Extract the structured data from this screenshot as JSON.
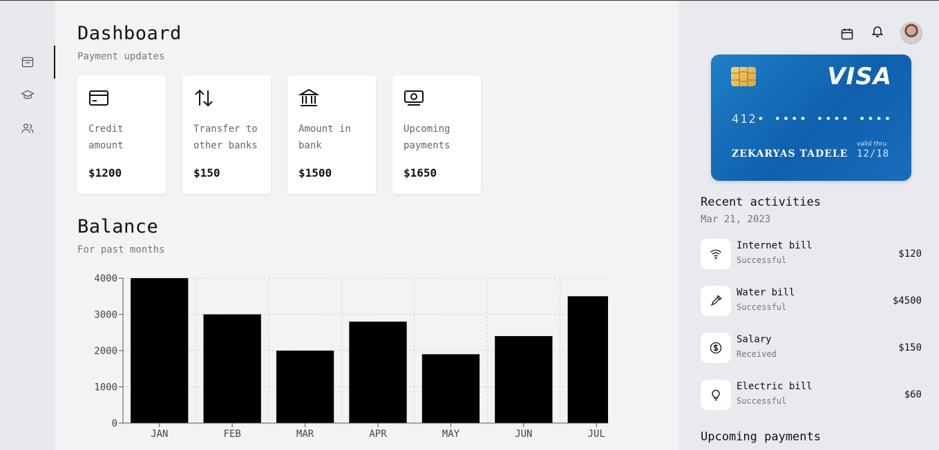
{
  "header": {
    "title": "Dashboard",
    "subtitle": "Payment updates"
  },
  "sidebar": {
    "items": [
      {
        "icon": "inbox-icon"
      },
      {
        "icon": "graduation-cap-icon"
      },
      {
        "icon": "users-icon"
      }
    ]
  },
  "cards": [
    {
      "label": "Credit amount",
      "value": "$1200",
      "icon": "credit-card-icon"
    },
    {
      "label": "Transfer to other banks",
      "value": "$150",
      "icon": "transfer-arrows-icon"
    },
    {
      "label": "Amount in bank",
      "value": "$1500",
      "icon": "bank-icon"
    },
    {
      "label": "Upcoming payments",
      "value": "$1650",
      "icon": "money-icon"
    }
  ],
  "balance": {
    "title": "Balance",
    "subtitle": "For past months"
  },
  "chart_data": {
    "type": "bar",
    "categories": [
      "JAN",
      "FEB",
      "MAR",
      "APR",
      "MAY",
      "JUN",
      "JUL"
    ],
    "values": [
      4000,
      3000,
      2000,
      2800,
      1900,
      2400,
      3500
    ],
    "yticks": [
      "0",
      "1000",
      "2000",
      "3000",
      "4000"
    ],
    "ylim": [
      0,
      4000
    ],
    "grid": true,
    "bar_color": "#000000"
  },
  "topbar": {
    "icons": [
      "calendar-icon",
      "bell-icon"
    ]
  },
  "card_visual": {
    "brand": "VISA",
    "number": "412• •••• •••• ••••",
    "holder": "ZEKARYAS TADELE",
    "valid_label": "valid thru",
    "valid": "12/18"
  },
  "recent": {
    "title": "Recent activities",
    "date": "Mar 21, 2023",
    "items": [
      {
        "name": "Internet bill",
        "status": "Successful",
        "amount": "$120",
        "icon": "wifi-icon"
      },
      {
        "name": "Water bill",
        "status": "Successful",
        "amount": "$4500",
        "icon": "dropper-icon"
      },
      {
        "name": "Salary",
        "status": "Received",
        "amount": "$150",
        "icon": "dollar-icon"
      },
      {
        "name": "Electric bill",
        "status": "Successful",
        "amount": "$60",
        "icon": "lightbulb-icon"
      }
    ]
  },
  "upcoming": {
    "title": "Upcoming payments"
  }
}
